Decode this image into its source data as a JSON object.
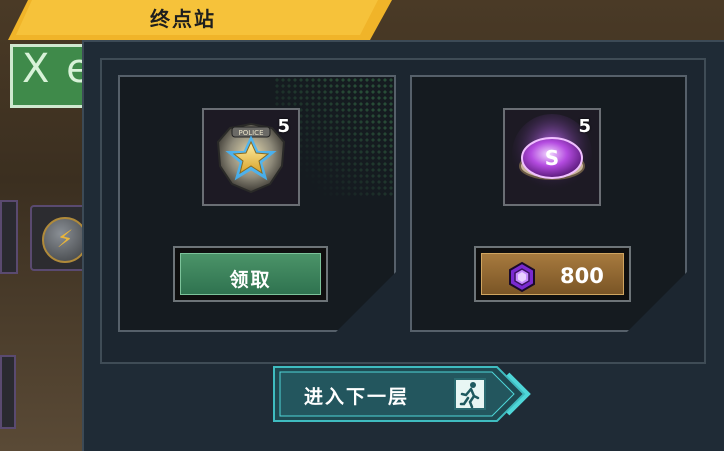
{
  "header": {
    "title": "终点站"
  },
  "background": {
    "sign_text": "X e",
    "lightning_glyph": "⚡"
  },
  "rewards": [
    {
      "name": "police-badge",
      "icon": "police-badge-icon",
      "count": "5",
      "button": {
        "label": "领取",
        "color": "#3d8a5e"
      }
    },
    {
      "name": "bottle-cap",
      "icon": "purple-bottle-cap-icon",
      "count": "5",
      "button": {
        "price": "800",
        "currency_icon": "purple-gem-icon",
        "color": "#9a6e36"
      }
    }
  ],
  "footer": {
    "next_floor_label": "进入下一层",
    "icon": "running-man-exit-icon"
  },
  "colors": {
    "accent_yellow": "#f6c23a",
    "panel": "#1f2b36",
    "teal": "#3fbcc0"
  }
}
